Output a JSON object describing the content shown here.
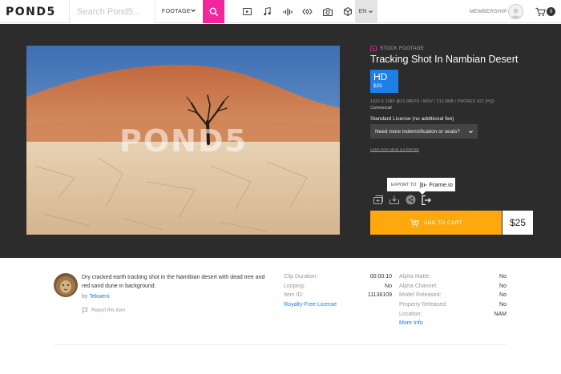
{
  "nav": {
    "logo": "POND5",
    "search_placeholder": "Search Pond5...",
    "filter_label": "FOOTAGE",
    "media_icons": [
      "video-icon",
      "music-icon",
      "sound-effects-icon",
      "after-effects-icon",
      "photo-icon",
      "3d-model-icon"
    ],
    "language": "EN",
    "membership": "MEMBERSHIP",
    "cart_count": "0",
    "accent_color": "#f2259d"
  },
  "preview": {
    "watermark": "POND5"
  },
  "product": {
    "kind": "STOCK FOOTAGE",
    "title": "Tracking Shot In Nambian Desert",
    "quality": "HD",
    "quality_price": "$25",
    "specs": "1920 X 1080 @23.98FPS / MOV / 212.5MB / PRORES 422 (HQ)",
    "usage": "Commercial",
    "license": "Standard License (no additional fee)",
    "indemnification": "Need more indemnification or seats?",
    "learn_more": "Learn more about our licenses",
    "export_label": "EXPORT TO",
    "export_target": "Frame.io",
    "add_to_cart": "ADD TO CART",
    "price": "$25",
    "quality_color": "#1f7fe8",
    "cart_color": "#ffa80e"
  },
  "details": {
    "description": "Dry cracked earth tracking shot in the Namibian desert with dead tree and red sand dune in background.",
    "by": "by",
    "author": "Tekweni",
    "report": "Report this item",
    "left_rows": [
      {
        "key": "Clip Duration:",
        "value": "00:00:10"
      },
      {
        "key": "Looping:",
        "value": "No"
      },
      {
        "key": "Item ID:",
        "value": "11138109"
      }
    ],
    "royalty_link": "Royalty-Free License",
    "right_rows": [
      {
        "key": "Alpha Matte:",
        "value": "No"
      },
      {
        "key": "Alpha Channel:",
        "value": "No"
      },
      {
        "key": "Model Released:",
        "value": "No"
      },
      {
        "key": "Property Released:",
        "value": "No"
      },
      {
        "key": "Location:",
        "value": "NAM"
      }
    ],
    "more_info": "More Info"
  }
}
